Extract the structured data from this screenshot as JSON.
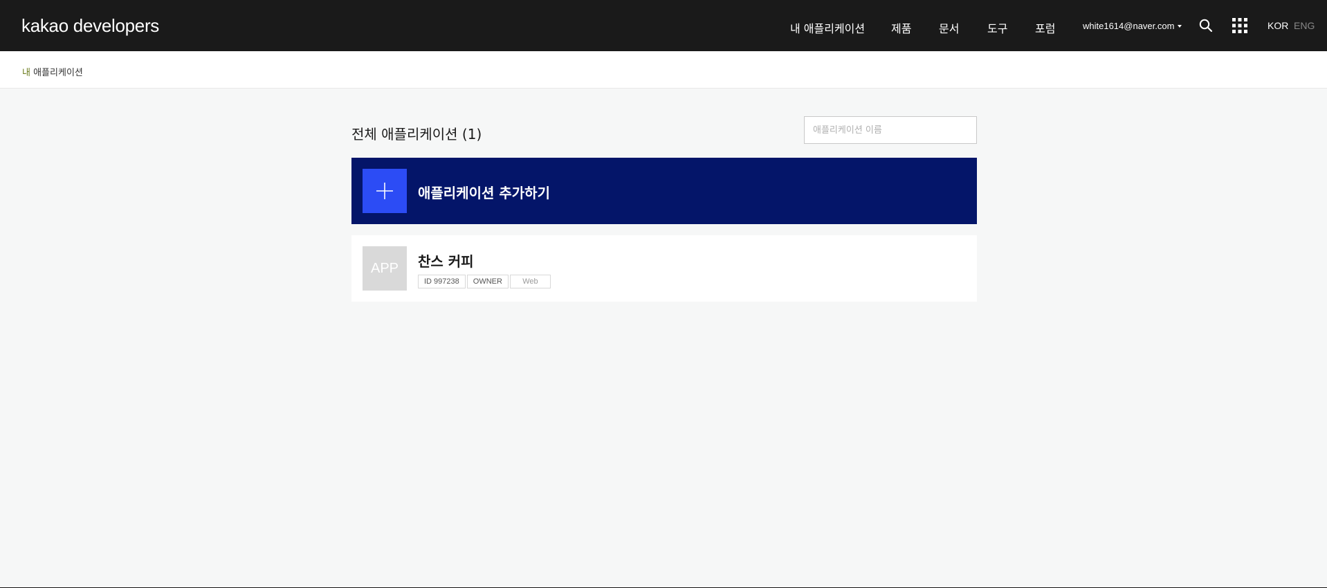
{
  "header": {
    "logo": "kakao developers",
    "nav": [
      "내 애플리케이션",
      "제품",
      "문서",
      "도구",
      "포럼"
    ],
    "user_email": "white1614@naver.com",
    "lang_kor": "KOR",
    "lang_eng": "ENG"
  },
  "breadcrumb": {
    "mine": "내",
    "rest": " 애플리케이션"
  },
  "main": {
    "title": "전체 애플리케이션 (1)",
    "search_placeholder": "애플리케이션 이름",
    "add_label": "애플리케이션 추가하기",
    "apps": [
      {
        "thumb": "APP",
        "name": "찬스 커피",
        "id_tag": "ID 997238",
        "role_tag": "OWNER",
        "platform_tag": "Web"
      }
    ]
  },
  "colors": {
    "header_bg": "#1a1a1a",
    "add_card_bg": "#041569",
    "accent_blue": "#2c4cf5"
  }
}
